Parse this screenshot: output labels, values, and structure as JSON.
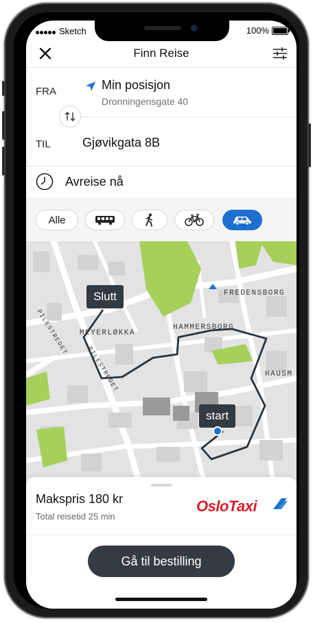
{
  "status": {
    "carrier": "Sketch",
    "battery": "100%"
  },
  "header": {
    "title": "Finn Reise"
  },
  "route": {
    "from_label": "FRA",
    "from_title": "Min posisjon",
    "from_subtitle": "Dronningensgate 40",
    "to_label": "TIL",
    "to_title": "Gjøvikgata 8B"
  },
  "departure": {
    "label": "Avreise nå"
  },
  "modes": {
    "all_label": "Alle",
    "items": [
      "bus-icon",
      "walk-icon",
      "bicycle-icon",
      "car-icon"
    ],
    "selected": "car-icon"
  },
  "map": {
    "street_labels": [
      "MEYERLØKKA",
      "HAMMERSBORG",
      "FREDENSBORG",
      "HAUSM",
      "PILESTREDET",
      "PILESTREDET"
    ],
    "pin_end": "Slutt",
    "pin_start": "start"
  },
  "summary": {
    "price": "Makspris 180 kr",
    "travel_time": "Total reisetid 25 min",
    "provider": "OsloTaxi"
  },
  "actions": {
    "order_label": "Gå til bestilling"
  },
  "colors": {
    "accent": "#1f6fd1",
    "park": "#a6d05a",
    "route_line": "#2b333b",
    "logo_red": "#d51f2b",
    "button_dark": "#353b42"
  }
}
